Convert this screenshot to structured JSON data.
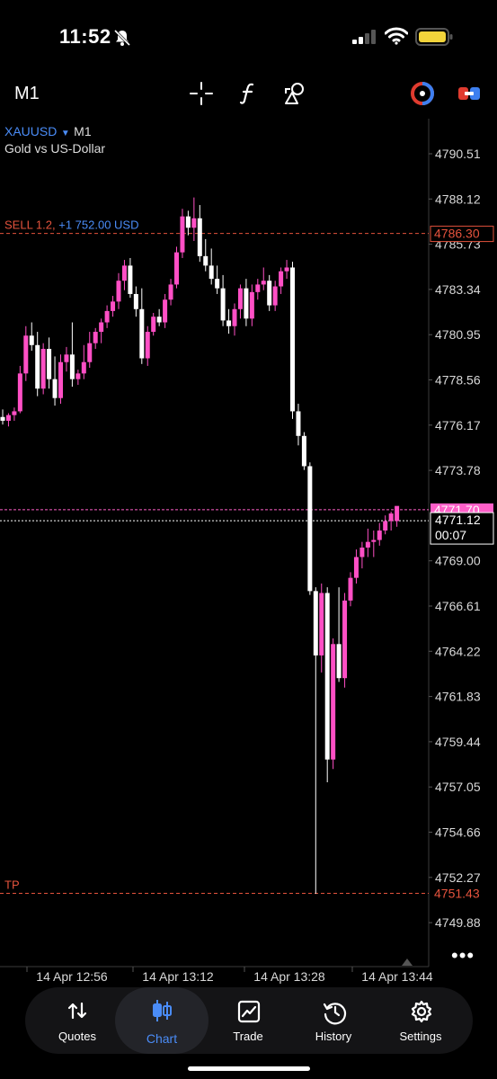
{
  "status_bar": {
    "time": "11:52"
  },
  "toolbar": {
    "timeframe": "M1"
  },
  "ticker": {
    "symbol": "XAUUSD",
    "timeframe": "M1",
    "description": "Gold vs US-Dollar"
  },
  "order": {
    "side_label": "SELL 1.2,",
    "pnl": "+1 752.00 USD",
    "price": "4786.30",
    "tp_label": "TP",
    "tp_price": "4751.43"
  },
  "price_tags": {
    "ask": "4771.70",
    "bid": "4771.12",
    "countdown": "00:07"
  },
  "colors": {
    "bull": "#ff4fc5",
    "bear": "#ffffff",
    "order_line": "#e5533d",
    "ask_line": "#ff5fc8",
    "ticker": "#4a8cf7",
    "pnl": "#4a8cf7",
    "tp": "#e5533d"
  },
  "chart_data": {
    "type": "candlestick",
    "y_ticks": [
      "4790.51",
      "4788.12",
      "4785.73",
      "4783.34",
      "4780.95",
      "4778.56",
      "4776.17",
      "4773.78",
      "4769.00",
      "4766.61",
      "4764.22",
      "4761.83",
      "4759.44",
      "4757.05",
      "4754.66",
      "4752.27",
      "4749.88"
    ],
    "x_ticks": [
      "14 Apr 12:56",
      "14 Apr 13:12",
      "14 Apr 13:28",
      "14 Apr 13:44"
    ],
    "candles": [
      [
        4776.6,
        4777.0,
        4776.2,
        4776.4
      ],
      [
        4776.4,
        4776.8,
        4776.1,
        4776.7
      ],
      [
        4776.7,
        4777.1,
        4776.4,
        4776.9
      ],
      [
        4776.9,
        4779.3,
        4776.8,
        4778.9
      ],
      [
        4778.9,
        4781.4,
        4778.5,
        4780.9
      ],
      [
        4780.9,
        4781.6,
        4780.1,
        4780.4
      ],
      [
        4780.4,
        4781.1,
        4777.7,
        4778.1
      ],
      [
        4778.1,
        4780.5,
        4777.8,
        4780.2
      ],
      [
        4780.2,
        4780.8,
        4778.1,
        4778.6
      ],
      [
        4778.6,
        4779.8,
        4777.2,
        4777.6
      ],
      [
        4777.6,
        4779.9,
        4777.3,
        4779.5
      ],
      [
        4779.5,
        4780.3,
        4779.0,
        4779.9
      ],
      [
        4779.9,
        4781.6,
        4778.2,
        4778.6
      ],
      [
        4778.6,
        4779.1,
        4778.3,
        4778.9
      ],
      [
        4778.9,
        4780.4,
        4778.6,
        4779.5
      ],
      [
        4779.5,
        4781.1,
        4779.2,
        4780.5
      ],
      [
        4780.5,
        4781.3,
        4780.2,
        4781.1
      ],
      [
        4781.1,
        4781.8,
        4780.5,
        4781.6
      ],
      [
        4781.6,
        4782.5,
        4781.3,
        4782.2
      ],
      [
        4782.2,
        4783.0,
        4781.9,
        4782.7
      ],
      [
        4782.7,
        4784.2,
        4782.3,
        4783.8
      ],
      [
        4783.8,
        4784.9,
        4783.3,
        4784.6
      ],
      [
        4784.6,
        4785.0,
        4782.9,
        4783.1
      ],
      [
        4783.1,
        4783.5,
        4781.9,
        4782.3
      ],
      [
        4782.3,
        4783.4,
        4779.4,
        4779.7
      ],
      [
        4779.7,
        4781.4,
        4779.3,
        4781.1
      ],
      [
        4781.1,
        4782.1,
        4780.9,
        4781.9
      ],
      [
        4781.9,
        4782.3,
        4781.4,
        4781.6
      ],
      [
        4781.6,
        4783.1,
        4781.3,
        4782.8
      ],
      [
        4782.8,
        4783.9,
        4782.5,
        4783.6
      ],
      [
        4783.6,
        4785.6,
        4783.4,
        4785.3
      ],
      [
        4785.3,
        4787.6,
        4785.0,
        4787.2
      ],
      [
        4787.2,
        4787.5,
        4786.2,
        4786.6
      ],
      [
        4786.6,
        4788.2,
        4785.9,
        4787.1
      ],
      [
        4787.1,
        4787.8,
        4784.8,
        4785.1
      ],
      [
        4785.1,
        4786.0,
        4784.3,
        4784.6
      ],
      [
        4784.6,
        4785.5,
        4783.6,
        4783.9
      ],
      [
        4783.9,
        4784.6,
        4783.1,
        4783.4
      ],
      [
        4783.4,
        4784.1,
        4781.4,
        4781.7
      ],
      [
        4781.7,
        4782.3,
        4781.0,
        4781.4
      ],
      [
        4781.4,
        4782.6,
        4780.9,
        4782.3
      ],
      [
        4782.3,
        4783.6,
        4781.8,
        4783.4
      ],
      [
        4783.4,
        4783.9,
        4781.4,
        4781.8
      ],
      [
        4781.8,
        4783.6,
        4781.4,
        4783.2
      ],
      [
        4783.2,
        4783.9,
        4782.8,
        4783.6
      ],
      [
        4783.6,
        4784.5,
        4783.3,
        4783.8
      ],
      [
        4783.8,
        4784.1,
        4782.2,
        4782.5
      ],
      [
        4782.5,
        4783.8,
        4782.2,
        4783.5
      ],
      [
        4783.5,
        4784.5,
        4783.1,
        4784.3
      ],
      [
        4784.3,
        4784.9,
        4783.9,
        4784.5
      ],
      [
        4784.5,
        4784.8,
        4776.5,
        4776.9
      ],
      [
        4776.9,
        4777.3,
        4775.1,
        4775.6
      ],
      [
        4775.6,
        4775.8,
        4773.8,
        4774.0
      ],
      [
        4774.0,
        4774.2,
        4767.2,
        4767.4
      ],
      [
        4767.4,
        4767.6,
        4751.4,
        4764.0
      ],
      [
        4764.0,
        4767.8,
        4763.1,
        4767.3
      ],
      [
        4767.3,
        4767.6,
        4757.3,
        4758.5
      ],
      [
        4758.5,
        4764.9,
        4758.0,
        4764.6
      ],
      [
        4764.6,
        4767.6,
        4762.6,
        4762.8
      ],
      [
        4762.8,
        4767.3,
        4762.3,
        4766.9
      ],
      [
        4766.9,
        4768.4,
        4766.6,
        4768.1
      ],
      [
        4768.1,
        4769.6,
        4767.8,
        4769.2
      ],
      [
        4769.2,
        4770.0,
        4768.6,
        4769.7
      ],
      [
        4769.7,
        4770.7,
        4769.2,
        4770.0
      ],
      [
        4770.0,
        4770.6,
        4769.2,
        4770.1
      ],
      [
        4770.1,
        4771.0,
        4769.8,
        4770.6
      ],
      [
        4770.6,
        4771.4,
        4770.4,
        4771.1
      ],
      [
        4771.1,
        4771.6,
        4770.6,
        4771.5
      ],
      [
        4771.1,
        4771.8,
        4770.8,
        4771.9
      ]
    ]
  },
  "nav": {
    "items": [
      {
        "label": "Quotes",
        "icon": "up-down-arrows-icon"
      },
      {
        "label": "Chart",
        "icon": "candlestick-icon"
      },
      {
        "label": "Trade",
        "icon": "line-chart-icon"
      },
      {
        "label": "History",
        "icon": "history-clock-icon"
      },
      {
        "label": "Settings",
        "icon": "gear-icon"
      }
    ]
  }
}
